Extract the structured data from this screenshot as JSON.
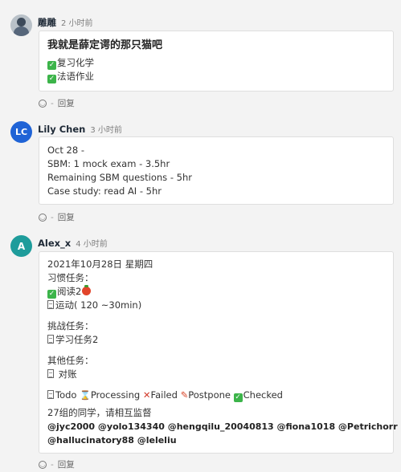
{
  "threads": [
    {
      "author": "雕雕",
      "time": "2 小时前",
      "title": "我就是薛定谔的那只猫吧",
      "lines": [
        "复习化学",
        "法语作业"
      ],
      "actions": {
        "separator": "-",
        "reply": "回复"
      }
    },
    {
      "author": "Lily Chen",
      "avatar_text": "LC",
      "time": "3 小时前",
      "lines": [
        "Oct 28 -",
        "SBM: 1 mock exam - 3.5hr",
        "Remaining SBM questions - 5hr",
        "Case study: read AI - 5hr"
      ],
      "actions": {
        "separator": "-",
        "reply": "回复"
      }
    },
    {
      "author": "Alex_x",
      "avatar_text": "A",
      "time": "4 小时前",
      "date": "2021年10月28日 星期四",
      "habit_title": "习惯任务：",
      "habit_items": [
        "阅读2",
        "运动( 120 ~30min)"
      ],
      "challenge_title": "挑战任务：",
      "challenge_items": [
        "学习任务2"
      ],
      "other_title": "其他任务：",
      "other_items": [
        "对账"
      ],
      "legend": {
        "todo": "Todo",
        "processing": "Processing",
        "failed": "Failed",
        "postpone": "Postpone",
        "checked": "Checked"
      },
      "group_text": "27组的同学，请相互监督",
      "mentions_line1": "@jyc2000 @yolo134340 @hengqilu_20040813 @fiona1018 @Petrichorr",
      "mentions_line2": "@hallucinatory88 @leleliu",
      "actions": {
        "separator": "-",
        "reply": "回复"
      }
    }
  ],
  "icons": {
    "emoji_reaction": "smile-icon",
    "checked": "check-mark-icon",
    "todo": "page-icon",
    "processing": "hourglass-icon",
    "failed": "cross-icon",
    "postpone": "pin-icon",
    "tomato": "tomato-icon"
  },
  "colors": {
    "lc_avatar": "#1f63d6",
    "a_avatar": "#1e9c9b",
    "check_green": "#3cb44a"
  }
}
